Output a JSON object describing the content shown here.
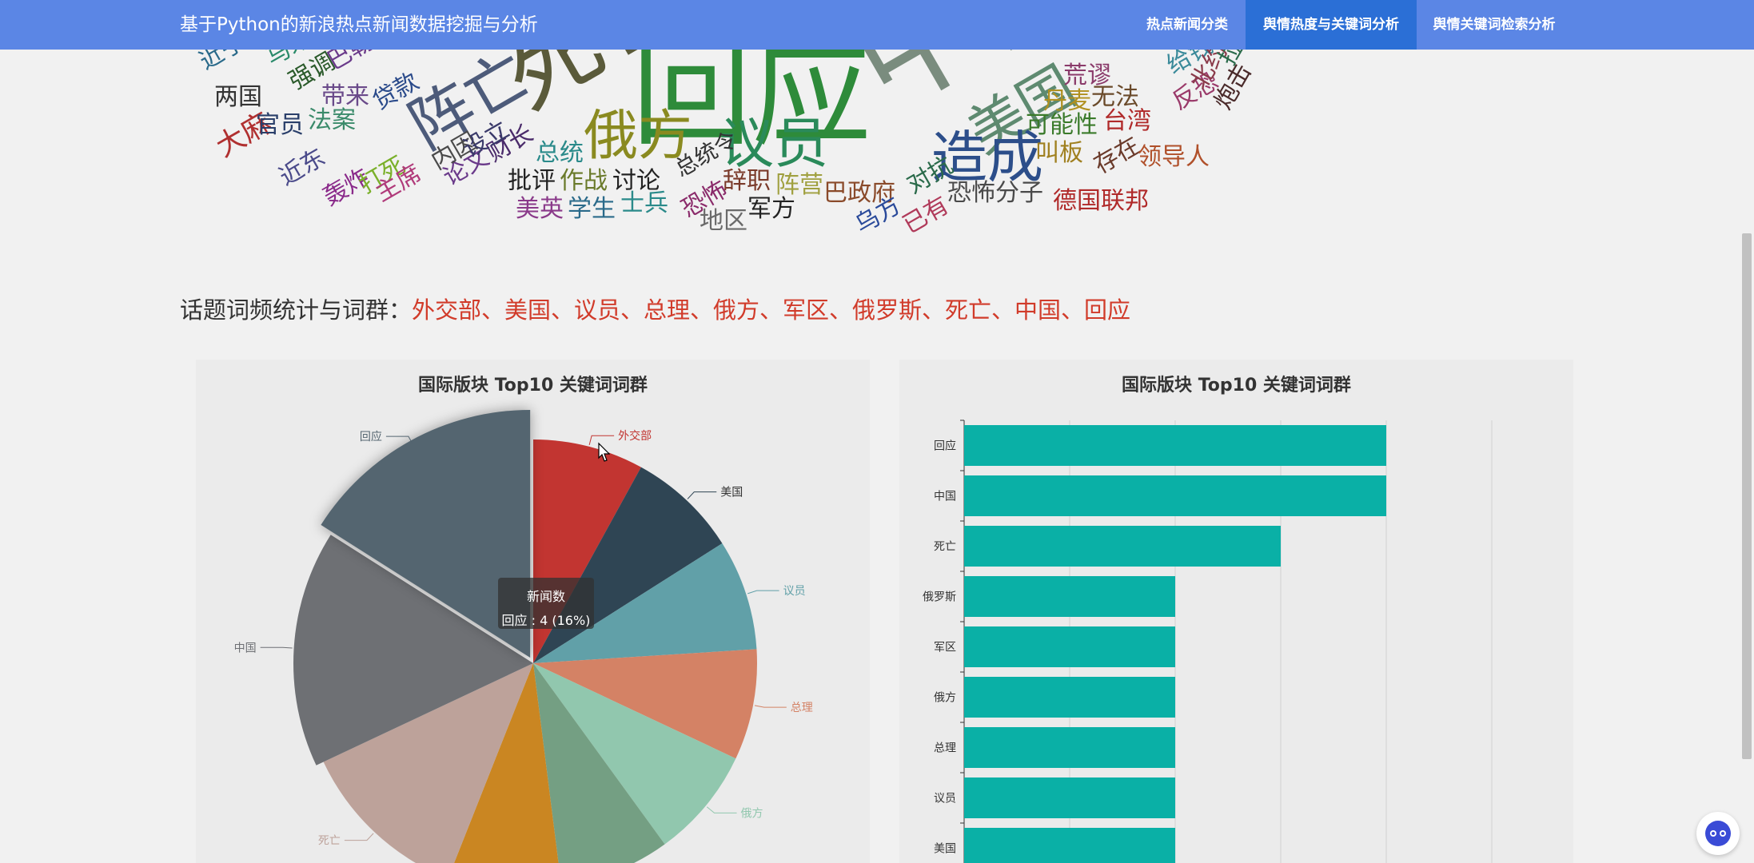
{
  "nav": {
    "brand": "基于Python的新浪热点新闻数据挖掘与分析",
    "items": [
      {
        "label": "热点新闻分类",
        "active": false
      },
      {
        "label": "舆情热度与关键词分析",
        "active": true
      },
      {
        "label": "舆情关键词检索分析",
        "active": false
      }
    ]
  },
  "wordcloud": {
    "words": [
      {
        "text": "回应",
        "color": "#2e8b3a"
      },
      {
        "text": "中国",
        "color": "#7a8c7e"
      },
      {
        "text": "死亡",
        "color": "#5a5a3a"
      },
      {
        "text": "美国",
        "color": "#5e8a70"
      },
      {
        "text": "阵亡",
        "color": "#4d5b7a"
      },
      {
        "text": "俄方",
        "color": "#8a8a20"
      },
      {
        "text": "议员",
        "color": "#2a8a5a"
      },
      {
        "text": "造成",
        "color": "#2c4e8a"
      },
      {
        "text": "两国",
        "color": "#333"
      },
      {
        "text": "大麻",
        "color": "#b03030"
      },
      {
        "text": "官员",
        "color": "#2a3f6a"
      },
      {
        "text": "法案",
        "color": "#3a8a6a"
      },
      {
        "text": "强调",
        "color": "#2a5a2a"
      },
      {
        "text": "带来",
        "color": "#6a4a8a"
      },
      {
        "text": "近东",
        "color": "#4a4a8a"
      },
      {
        "text": "轰炸",
        "color": "#8a2a8a"
      },
      {
        "text": "打死",
        "color": "#7ab02a"
      },
      {
        "text": "主席",
        "color": "#b03a7a"
      },
      {
        "text": "贷款",
        "color": "#2a4a8a"
      },
      {
        "text": "论文",
        "color": "#6a3a8a"
      },
      {
        "text": "财长",
        "color": "#4a2a6a"
      },
      {
        "text": "内因",
        "color": "#4a4a4a"
      },
      {
        "text": "设立",
        "color": "#3a3a6a"
      },
      {
        "text": "总统",
        "color": "#2a8a8a"
      },
      {
        "text": "批评",
        "color": "#222"
      },
      {
        "text": "作战",
        "color": "#6a7a2a"
      },
      {
        "text": "讨论",
        "color": "#222"
      },
      {
        "text": "总统令",
        "color": "#333"
      },
      {
        "text": "恐怖",
        "color": "#8a2a6a"
      },
      {
        "text": "辞职",
        "color": "#7a3a2a"
      },
      {
        "text": "阵营",
        "color": "#a0a040"
      },
      {
        "text": "美英",
        "color": "#8a3a8a"
      },
      {
        "text": "学生",
        "color": "#2a6a8a"
      },
      {
        "text": "士兵",
        "color": "#2a8a8a"
      },
      {
        "text": "地区",
        "color": "#6a6a6a"
      },
      {
        "text": "军方",
        "color": "#222"
      },
      {
        "text": "巴政府",
        "color": "#8a4a2a"
      },
      {
        "text": "乌方",
        "color": "#2a4a9a"
      },
      {
        "text": "对抗",
        "color": "#2a6a4a"
      },
      {
        "text": "已有",
        "color": "#b03a5a"
      },
      {
        "text": "恐怖分子",
        "color": "#4a4a4a"
      },
      {
        "text": "德国联邦",
        "color": "#b02a2a"
      },
      {
        "text": "可能性",
        "color": "#3a7a2a"
      },
      {
        "text": "叫板",
        "color": "#a08020"
      },
      {
        "text": "丹麦",
        "color": "#b09020"
      },
      {
        "text": "台湾",
        "color": "#b02a2a"
      },
      {
        "text": "荒谬",
        "color": "#8a3a6a"
      },
      {
        "text": "存在",
        "color": "#6a3a2a"
      },
      {
        "text": "无法",
        "color": "#6a4a2a"
      },
      {
        "text": "反恐",
        "color": "#9a3a6a"
      },
      {
        "text": "领导人",
        "color": "#b0502a"
      },
      {
        "text": "给钱",
        "color": "#3a8a9a"
      },
      {
        "text": "北约",
        "color": "#8a3a4a"
      },
      {
        "text": "拉瑙",
        "color": "#2a6a4a"
      },
      {
        "text": "炮击",
        "color": "#4a2a2a"
      },
      {
        "text": "马来",
        "color": "#2a8a6a"
      },
      {
        "text": "巴勒",
        "color": "#6a3a8a"
      },
      {
        "text": "近乎",
        "color": "#2a6a8a"
      }
    ]
  },
  "topic": {
    "label": "话题词频统计与词群：",
    "keywords": "外交部、美国、议员、总理、俄方、军区、俄罗斯、死亡、中国、回应"
  },
  "pie_panel": {
    "title": "国际版块 Top10 关键词词群"
  },
  "bar_panel": {
    "title": "国际版块 Top10 关键词词群"
  },
  "tooltip": {
    "title": "新闻数",
    "body": "回应 : 4 (16%)"
  },
  "chart_data": [
    {
      "type": "pie",
      "title": "国际版块 Top10 关键词词群",
      "series_name": "新闻数",
      "rose": true,
      "slices": [
        {
          "name": "外交部",
          "value": 2,
          "color": "#c23531"
        },
        {
          "name": "美国",
          "value": 2,
          "color": "#2f4554"
        },
        {
          "name": "议员",
          "value": 2,
          "color": "#61a0a8"
        },
        {
          "name": "总理",
          "value": 2,
          "color": "#d48265"
        },
        {
          "name": "俄方",
          "value": 2,
          "color": "#91c7ae"
        },
        {
          "name": "军区",
          "value": 2,
          "color": "#749f83"
        },
        {
          "name": "俄罗斯",
          "value": 2,
          "color": "#ca8622"
        },
        {
          "name": "死亡",
          "value": 3,
          "color": "#bda29a"
        },
        {
          "name": "中国",
          "value": 4,
          "color": "#6e7074"
        },
        {
          "name": "回应",
          "value": 4,
          "color": "#546570"
        }
      ]
    },
    {
      "type": "bar",
      "orientation": "horizontal",
      "title": "国际版块 Top10 关键词词群",
      "categories": [
        "回应",
        "中国",
        "死亡",
        "俄罗斯",
        "军区",
        "俄方",
        "总理",
        "议员",
        "美国"
      ],
      "values": [
        4,
        4,
        3,
        2,
        2,
        2,
        2,
        2,
        2
      ],
      "xlim": [
        0,
        5
      ],
      "grid": true,
      "color": "#0ab0a6"
    }
  ]
}
